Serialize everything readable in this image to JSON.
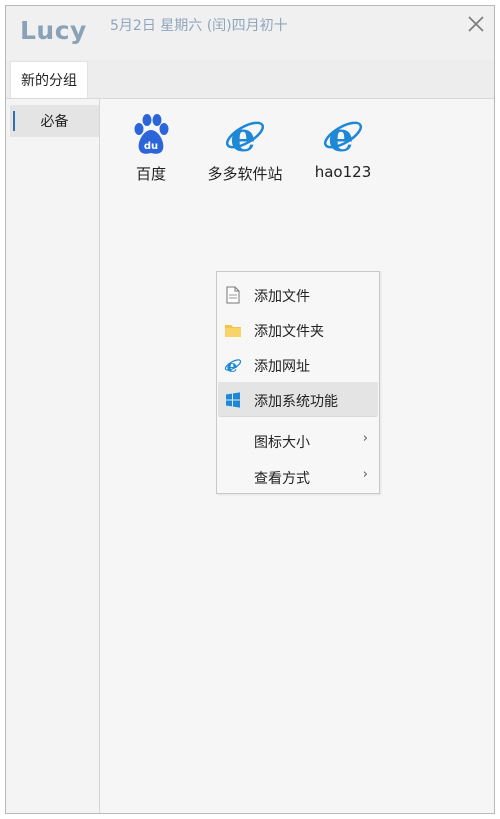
{
  "app": {
    "title": "Lucy",
    "date": "5月2日 星期六 (闰)四月初十"
  },
  "tabs": [
    {
      "label": "新的分组"
    }
  ],
  "sidebar": {
    "items": [
      {
        "label": "必备"
      }
    ]
  },
  "shortcuts": [
    {
      "label": "百度",
      "icon": "baidu-icon"
    },
    {
      "label": "多多软件站",
      "icon": "ie-icon"
    },
    {
      "label": "hao123",
      "icon": "ie-icon"
    }
  ],
  "context_menu": {
    "items": [
      {
        "label": "添加文件",
        "icon": "file-icon"
      },
      {
        "label": "添加文件夹",
        "icon": "folder-icon"
      },
      {
        "label": "添加网址",
        "icon": "ie-icon"
      },
      {
        "label": "添加系统功能",
        "icon": "windows-icon",
        "highlighted": true
      },
      {
        "label": "图标大小",
        "submenu_arrow": "›"
      },
      {
        "label": "查看方式",
        "submenu_arrow": "›"
      }
    ]
  },
  "colors": {
    "title": "#8aa1b8",
    "accent": "#2f6fb5",
    "ie_blue": "#1e88d6",
    "baidu_blue": "#2b65d9",
    "folder": "#f4c542"
  }
}
